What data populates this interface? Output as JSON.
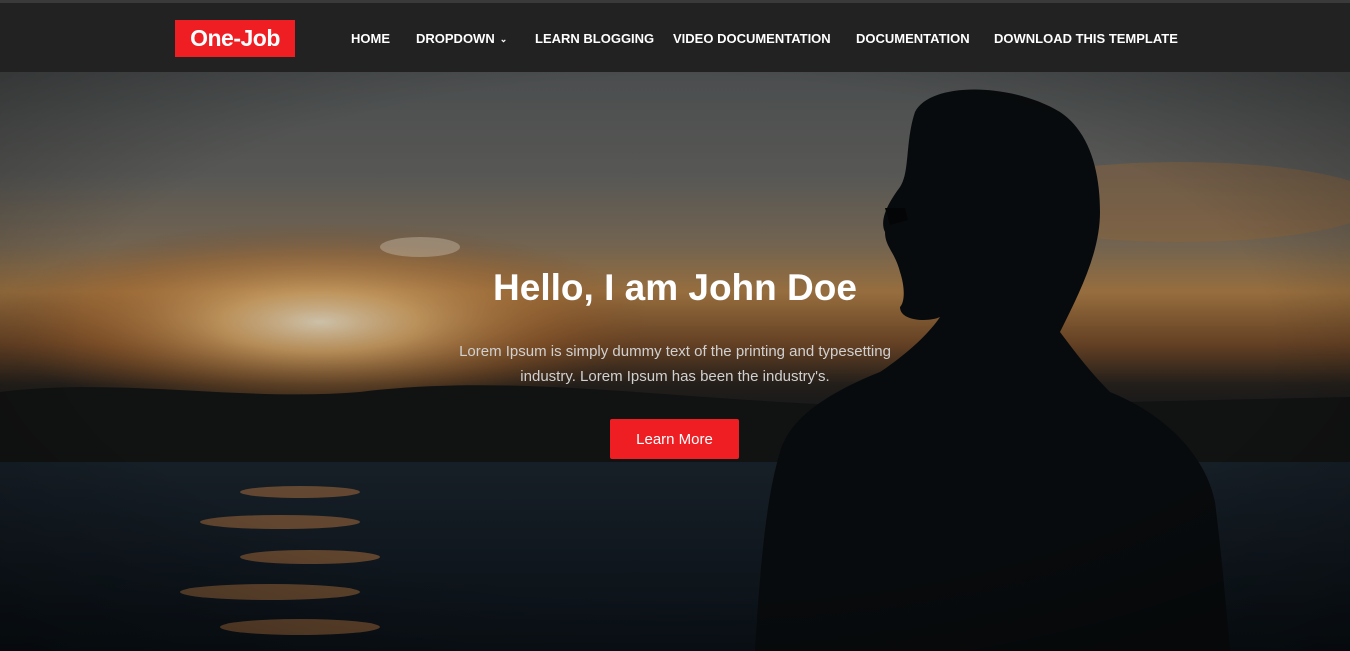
{
  "brand": {
    "logo_text": "One-Job",
    "accent": "#ee1e23"
  },
  "nav": {
    "items": [
      {
        "label": "HOME"
      },
      {
        "label": "DROPDOWN",
        "has_dropdown": true,
        "icon": "chevron-down-icon"
      },
      {
        "label": "LEARN BLOGGING"
      },
      {
        "label": "VIDEO DOCUMENTATION"
      },
      {
        "label": "DOCUMENTATION"
      },
      {
        "label": "DOWNLOAD THIS TEMPLATE"
      }
    ],
    "chevron": "⌄"
  },
  "hero": {
    "title": "Hello, I am John Doe",
    "text_line1": "Lorem Ipsum is simply dummy text of the printing and typesetting",
    "text_line2": "industry. Lorem Ipsum has been the industry's.",
    "button_label": "Learn More"
  }
}
